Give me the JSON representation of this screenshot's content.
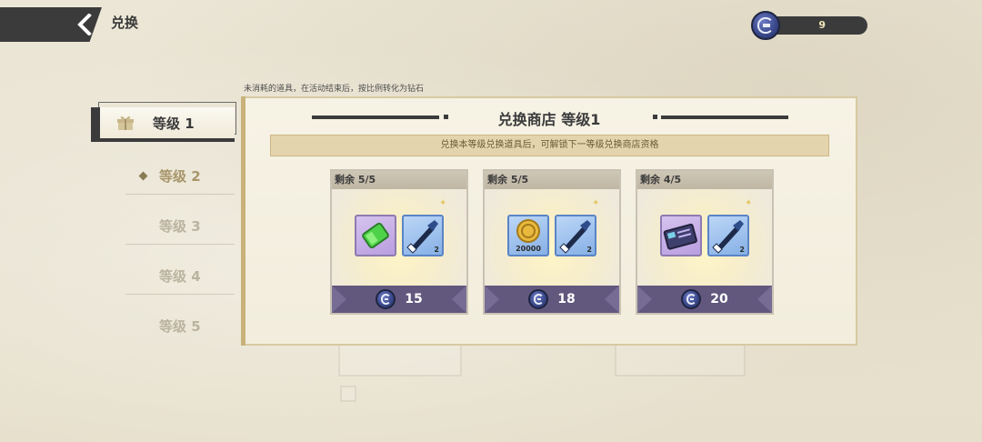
{
  "header": {
    "title": "兑换",
    "currency_amount": "9"
  },
  "notice": "未消耗的道具，在活动结束后，按比例转化为钻石",
  "tabs": [
    {
      "label": "等级 1"
    },
    {
      "label": "等级 2"
    },
    {
      "label": "等级 3"
    },
    {
      "label": "等级 4"
    },
    {
      "label": "等级 5"
    }
  ],
  "shop": {
    "title": "兑换商店 等级1",
    "banner": "兑换本等级兑换道具后，可解锁下一等级兑换商店资格",
    "cards": [
      {
        "remaining": "剩余 5/5",
        "item1": "green-crystal",
        "item2_qty": "2",
        "price": "15"
      },
      {
        "remaining": "剩余 5/5",
        "item1": "gold-coin",
        "item1_qty": "20000",
        "item2_qty": "2",
        "price": "18"
      },
      {
        "remaining": "剩余 4/5",
        "item1": "purple-card",
        "item2_qty": "2",
        "price": "20"
      }
    ]
  },
  "colors": {
    "accent_dark": "#3b3b3c",
    "card_footer": "#62587e",
    "banner_bg": "#e4d4ad"
  }
}
